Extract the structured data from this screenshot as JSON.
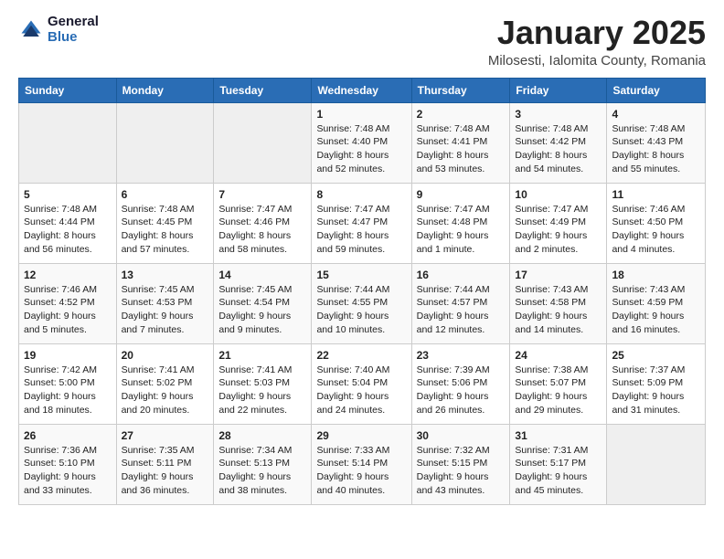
{
  "header": {
    "logo_general": "General",
    "logo_blue": "Blue",
    "title": "January 2025",
    "location": "Milosesti, Ialomita County, Romania"
  },
  "days_of_week": [
    "Sunday",
    "Monday",
    "Tuesday",
    "Wednesday",
    "Thursday",
    "Friday",
    "Saturday"
  ],
  "weeks": [
    [
      {
        "day": "",
        "empty": true
      },
      {
        "day": "",
        "empty": true
      },
      {
        "day": "",
        "empty": true
      },
      {
        "day": "1",
        "sunrise": "7:48 AM",
        "sunset": "4:40 PM",
        "daylight": "8 hours and 52 minutes."
      },
      {
        "day": "2",
        "sunrise": "7:48 AM",
        "sunset": "4:41 PM",
        "daylight": "8 hours and 53 minutes."
      },
      {
        "day": "3",
        "sunrise": "7:48 AM",
        "sunset": "4:42 PM",
        "daylight": "8 hours and 54 minutes."
      },
      {
        "day": "4",
        "sunrise": "7:48 AM",
        "sunset": "4:43 PM",
        "daylight": "8 hours and 55 minutes."
      }
    ],
    [
      {
        "day": "5",
        "sunrise": "7:48 AM",
        "sunset": "4:44 PM",
        "daylight": "8 hours and 56 minutes."
      },
      {
        "day": "6",
        "sunrise": "7:48 AM",
        "sunset": "4:45 PM",
        "daylight": "8 hours and 57 minutes."
      },
      {
        "day": "7",
        "sunrise": "7:47 AM",
        "sunset": "4:46 PM",
        "daylight": "8 hours and 58 minutes."
      },
      {
        "day": "8",
        "sunrise": "7:47 AM",
        "sunset": "4:47 PM",
        "daylight": "8 hours and 59 minutes."
      },
      {
        "day": "9",
        "sunrise": "7:47 AM",
        "sunset": "4:48 PM",
        "daylight": "9 hours and 1 minute."
      },
      {
        "day": "10",
        "sunrise": "7:47 AM",
        "sunset": "4:49 PM",
        "daylight": "9 hours and 2 minutes."
      },
      {
        "day": "11",
        "sunrise": "7:46 AM",
        "sunset": "4:50 PM",
        "daylight": "9 hours and 4 minutes."
      }
    ],
    [
      {
        "day": "12",
        "sunrise": "7:46 AM",
        "sunset": "4:52 PM",
        "daylight": "9 hours and 5 minutes."
      },
      {
        "day": "13",
        "sunrise": "7:45 AM",
        "sunset": "4:53 PM",
        "daylight": "9 hours and 7 minutes."
      },
      {
        "day": "14",
        "sunrise": "7:45 AM",
        "sunset": "4:54 PM",
        "daylight": "9 hours and 9 minutes."
      },
      {
        "day": "15",
        "sunrise": "7:44 AM",
        "sunset": "4:55 PM",
        "daylight": "9 hours and 10 minutes."
      },
      {
        "day": "16",
        "sunrise": "7:44 AM",
        "sunset": "4:57 PM",
        "daylight": "9 hours and 12 minutes."
      },
      {
        "day": "17",
        "sunrise": "7:43 AM",
        "sunset": "4:58 PM",
        "daylight": "9 hours and 14 minutes."
      },
      {
        "day": "18",
        "sunrise": "7:43 AM",
        "sunset": "4:59 PM",
        "daylight": "9 hours and 16 minutes."
      }
    ],
    [
      {
        "day": "19",
        "sunrise": "7:42 AM",
        "sunset": "5:00 PM",
        "daylight": "9 hours and 18 minutes."
      },
      {
        "day": "20",
        "sunrise": "7:41 AM",
        "sunset": "5:02 PM",
        "daylight": "9 hours and 20 minutes."
      },
      {
        "day": "21",
        "sunrise": "7:41 AM",
        "sunset": "5:03 PM",
        "daylight": "9 hours and 22 minutes."
      },
      {
        "day": "22",
        "sunrise": "7:40 AM",
        "sunset": "5:04 PM",
        "daylight": "9 hours and 24 minutes."
      },
      {
        "day": "23",
        "sunrise": "7:39 AM",
        "sunset": "5:06 PM",
        "daylight": "9 hours and 26 minutes."
      },
      {
        "day": "24",
        "sunrise": "7:38 AM",
        "sunset": "5:07 PM",
        "daylight": "9 hours and 29 minutes."
      },
      {
        "day": "25",
        "sunrise": "7:37 AM",
        "sunset": "5:09 PM",
        "daylight": "9 hours and 31 minutes."
      }
    ],
    [
      {
        "day": "26",
        "sunrise": "7:36 AM",
        "sunset": "5:10 PM",
        "daylight": "9 hours and 33 minutes."
      },
      {
        "day": "27",
        "sunrise": "7:35 AM",
        "sunset": "5:11 PM",
        "daylight": "9 hours and 36 minutes."
      },
      {
        "day": "28",
        "sunrise": "7:34 AM",
        "sunset": "5:13 PM",
        "daylight": "9 hours and 38 minutes."
      },
      {
        "day": "29",
        "sunrise": "7:33 AM",
        "sunset": "5:14 PM",
        "daylight": "9 hours and 40 minutes."
      },
      {
        "day": "30",
        "sunrise": "7:32 AM",
        "sunset": "5:15 PM",
        "daylight": "9 hours and 43 minutes."
      },
      {
        "day": "31",
        "sunrise": "7:31 AM",
        "sunset": "5:17 PM",
        "daylight": "9 hours and 45 minutes."
      },
      {
        "day": "",
        "empty": true
      }
    ]
  ]
}
